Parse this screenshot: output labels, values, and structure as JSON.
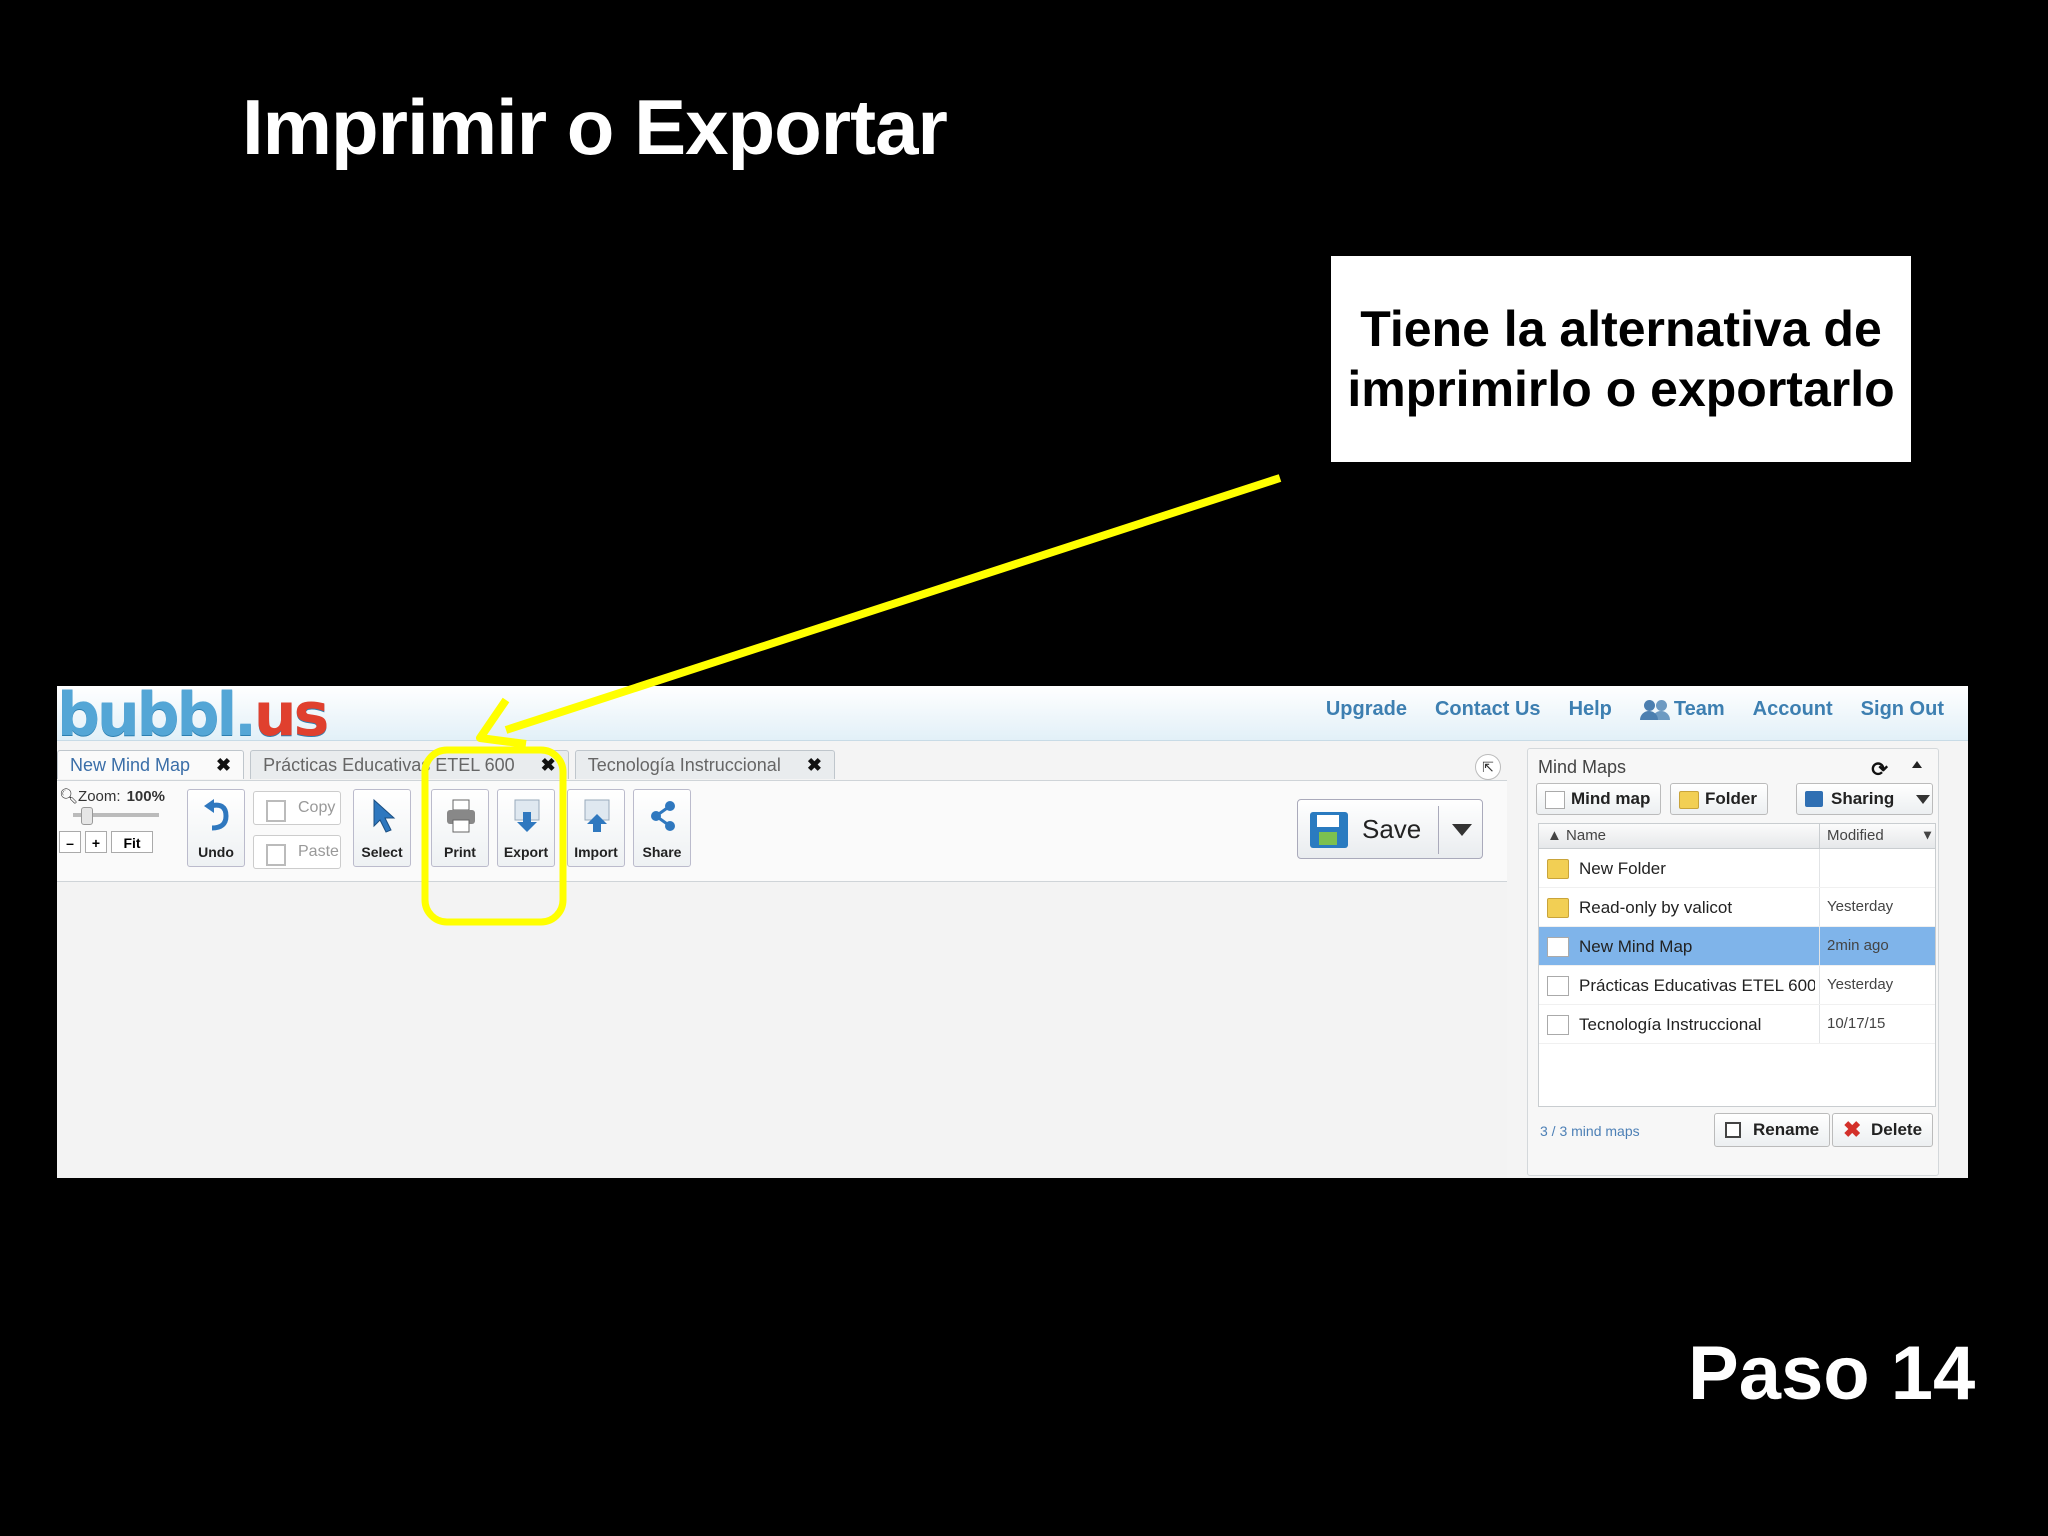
{
  "slide": {
    "title": "Imprimir o Exportar",
    "callout": "Tiene la alternativa de imprimirlo o exportarlo",
    "step": "Paso 14",
    "highlight_color": "#ffff00"
  },
  "app": {
    "logo_main": "bubbl.",
    "logo_accent": "us",
    "nav": [
      "Upgrade",
      "Contact Us",
      "Help",
      "Team",
      "Account",
      "Sign Out"
    ],
    "tabs": [
      {
        "label": "New Mind Map",
        "active": true
      },
      {
        "label": "Prácticas Educativas ETEL 600",
        "active": false
      },
      {
        "label": "Tecnología Instruccional",
        "active": false
      }
    ],
    "close_glyph": "✖",
    "zoom_label": "Zoom:",
    "zoom_value": "100%",
    "zoom_minus": "–",
    "zoom_plus": "+",
    "fit": "Fit",
    "tools": {
      "undo": "Undo",
      "copy": "Copy",
      "paste": "Paste",
      "select": "Select",
      "print": "Print",
      "export": "Export",
      "import": "Import",
      "share": "Share"
    },
    "save": "Save"
  },
  "panel": {
    "title": "Mind Maps",
    "buttons": {
      "mindmap": "Mind map",
      "folder": "Folder",
      "sharing": "Sharing"
    },
    "columns": {
      "name": "Name",
      "modified": "Modified"
    },
    "rows": [
      {
        "type": "folder",
        "name": "New Folder",
        "modified": ""
      },
      {
        "type": "folder",
        "name": "Read-only by valicot",
        "modified": "Yesterday"
      },
      {
        "type": "doc",
        "name": "New Mind Map",
        "modified": "2min ago",
        "selected": true
      },
      {
        "type": "doc",
        "name": "Prácticas Educativas ETEL 600",
        "modified": "Yesterday"
      },
      {
        "type": "doc",
        "name": "Tecnología Instruccional",
        "modified": "10/17/15"
      }
    ],
    "count": "3 / 3 mind maps",
    "rename": "Rename",
    "delete": "Delete"
  }
}
